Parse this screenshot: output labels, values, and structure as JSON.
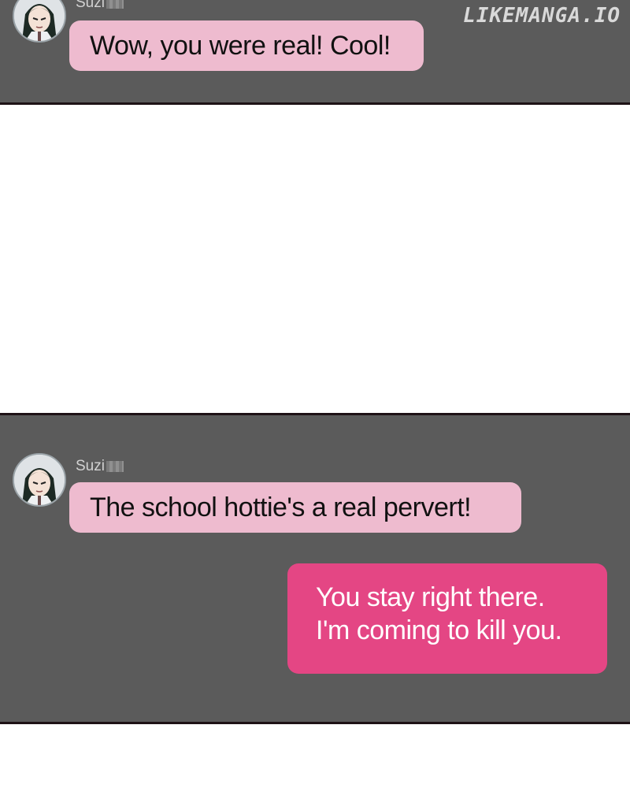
{
  "watermark": "LIKEMANGA.IO",
  "colors": {
    "panel_bg": "#5b5b5b",
    "incoming_bubble": "#eebbcf",
    "outgoing_bubble": "#e44684",
    "gap_bg": "#ffffff"
  },
  "top_panel": {
    "sender": "Suzi",
    "messages": [
      {
        "text": "Wow, you were real! Cool!"
      }
    ]
  },
  "bottom_panel": {
    "sender": "Suzi",
    "incoming": "The school hottie's a real pervert!",
    "outgoing_lines": [
      "You stay right there.",
      "I'm coming to kill you."
    ]
  }
}
